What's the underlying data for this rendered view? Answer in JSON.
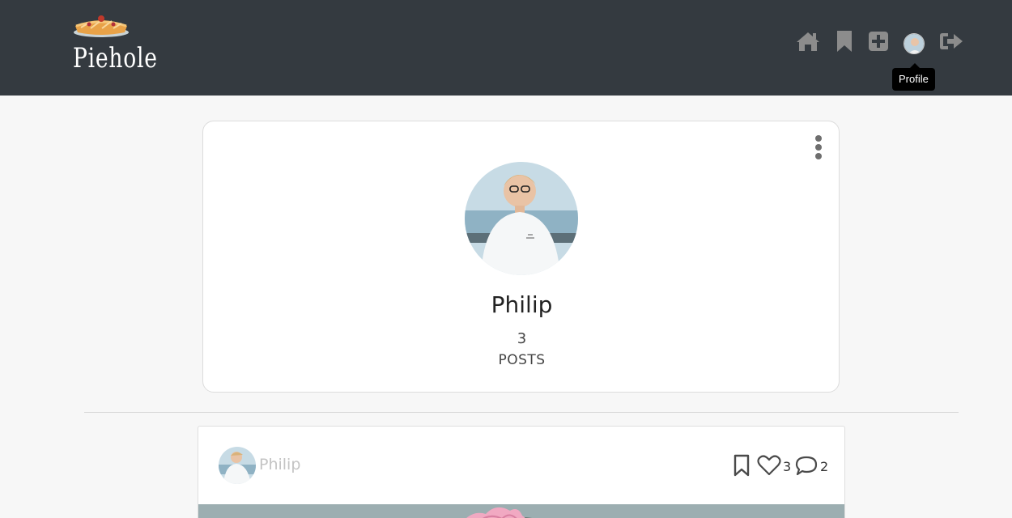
{
  "header": {
    "brand_name": "Piehole",
    "nav": {
      "home_icon": "home-icon",
      "bookmarks_icon": "bookmark-icon",
      "create_icon": "plus-square-icon",
      "profile_icon": "avatar",
      "logout_icon": "sign-out-icon"
    },
    "tooltip": "Profile"
  },
  "profile": {
    "name": "Philip",
    "post_count": "3",
    "post_label": "POSTS",
    "menu_icon": "kebab-menu-icon"
  },
  "post": {
    "author": "Philip",
    "likes": "3",
    "comments": "2",
    "bookmark_icon": "bookmark-outline-icon",
    "like_icon": "heart-outline-icon",
    "comment_icon": "speech-bubble-icon"
  },
  "colors": {
    "header_bg": "#343a40",
    "nav_icon": "#8c8c8c",
    "page_bg": "#f7f7f7"
  }
}
